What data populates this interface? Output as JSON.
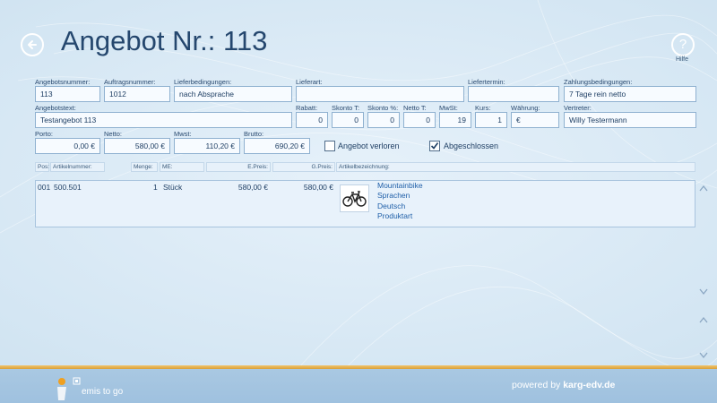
{
  "header": {
    "title": "Angebot Nr.: 113",
    "help_label": "Hilfe",
    "help_glyph": "?"
  },
  "form": {
    "angebotsnummer": {
      "label": "Angebotsnummer:",
      "value": "113"
    },
    "auftragsnummer": {
      "label": "Auftragsnummer:",
      "value": "1012"
    },
    "lieferbedingungen": {
      "label": "Lieferbedingungen:",
      "value": "nach Absprache"
    },
    "lieferart": {
      "label": "Lieferart:",
      "value": ""
    },
    "liefertermin": {
      "label": "Liefertermin:",
      "value": ""
    },
    "zahlungsbedingungen": {
      "label": "Zahlungsbedingungen:",
      "value": "7 Tage rein netto"
    },
    "angebotstext": {
      "label": "Angebotstext:",
      "value": "Testangebot 113"
    },
    "rabatt": {
      "label": "Rabatt:",
      "value": "0"
    },
    "skonto_t": {
      "label": "Skonto T:",
      "value": "0"
    },
    "skonto_p": {
      "label": "Skonto %:",
      "value": "0"
    },
    "netto_t": {
      "label": "Netto T:",
      "value": "0"
    },
    "mwst": {
      "label": "MwSt:",
      "value": "19"
    },
    "kurs": {
      "label": "Kurs:",
      "value": "1"
    },
    "waehrung": {
      "label": "Währung:",
      "value": "€"
    },
    "vertreter": {
      "label": "Vertreter:",
      "value": "Willy Testermann"
    },
    "porto": {
      "label": "Porto:",
      "value": "0,00 €"
    },
    "netto": {
      "label": "Netto:",
      "value": "580,00 €"
    },
    "mwst_betrag": {
      "label": "Mwst:",
      "value": "110,20 €"
    },
    "brutto": {
      "label": "Brutto:",
      "value": "690,20 €"
    },
    "angebot_verloren": {
      "label": "Angebot verloren",
      "checked": false
    },
    "abgeschlossen": {
      "label": "Abgeschlossen",
      "checked": true
    }
  },
  "positions": {
    "columns": [
      "Pos:",
      "Artikelnummer:",
      "Menge:",
      "ME:",
      "E.Preis:",
      "G.Preis:",
      "Artikelbezeichnung:"
    ],
    "rows": [
      {
        "pos": "001",
        "artikelnummer": "500.501",
        "menge": "1",
        "me": "Stück",
        "epreis": "580,00 €",
        "gpreis": "580,00 €",
        "image_icon": "bicycle-icon",
        "bezeichnung": [
          "Mountainbike",
          "Sprachen",
          "Deutsch",
          "Produktart"
        ]
      }
    ]
  },
  "footer": {
    "logo_text": "emis to go",
    "powered_prefix": "powered by ",
    "powered_brand": "karg-edv.de"
  }
}
